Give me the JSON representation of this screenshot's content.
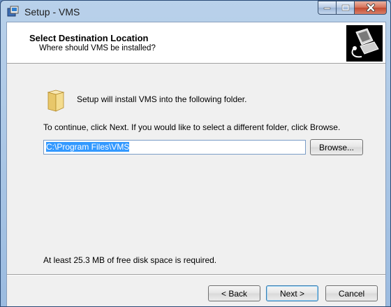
{
  "window": {
    "title": "Setup - VMS",
    "caption_buttons": [
      "minimize",
      "maximize",
      "close"
    ]
  },
  "header": {
    "title": "Select Destination Location",
    "subtitle": "Where should VMS be installed?"
  },
  "body": {
    "intro": "Setup will install VMS into the following folder.",
    "continue_text": "To continue, click Next. If you would like to select a different folder, click Browse.",
    "path_value": "C:\\Program Files\\VMS",
    "browse_label": "Browse...",
    "space_required": "At least 25.3 MB of free disk space is required."
  },
  "footer": {
    "back_label": "< Back",
    "next_label": "Next >",
    "cancel_label": "Cancel"
  }
}
